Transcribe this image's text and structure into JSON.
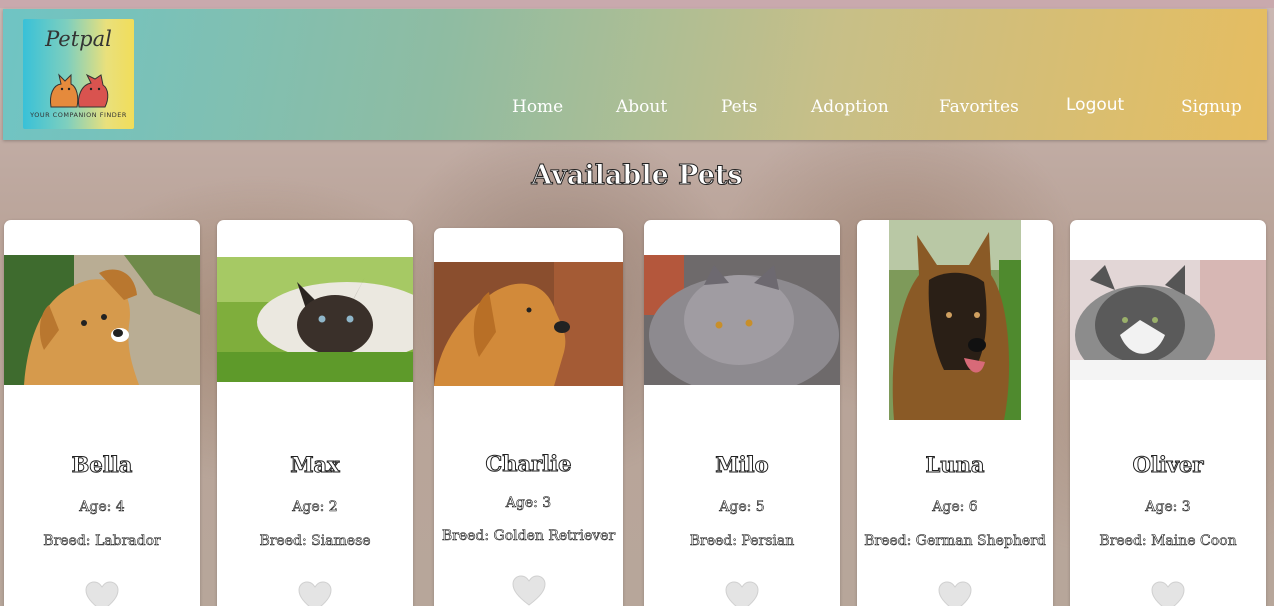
{
  "header": {
    "logo": {
      "name": "Petpal",
      "tagline": "YOUR COMPANION FINDER"
    },
    "nav": [
      {
        "label": "Home"
      },
      {
        "label": "About"
      },
      {
        "label": "Pets"
      },
      {
        "label": "Adoption"
      },
      {
        "label": "Favorites"
      },
      {
        "label": "Logout"
      },
      {
        "label": "Signup"
      }
    ]
  },
  "main": {
    "title": "Available Pets",
    "pets": [
      {
        "name": "Bella",
        "age": "Age: 4",
        "breed": "Breed: Labrador",
        "photo": "dog-photo"
      },
      {
        "name": "Max",
        "age": "Age: 2",
        "breed": "Breed: Siamese",
        "photo": "cat-photo"
      },
      {
        "name": "Charlie",
        "age": "Age: 3",
        "breed": "Breed: Golden Retriever",
        "photo": "dog-photo"
      },
      {
        "name": "Milo",
        "age": "Age: 5",
        "breed": "Breed: Persian",
        "photo": "cat-photo"
      },
      {
        "name": "Luna",
        "age": "Age: 6",
        "breed": "Breed: German Shepherd",
        "photo": "dog-photo"
      },
      {
        "name": "Oliver",
        "age": "Age: 3",
        "breed": "Breed: Maine Coon",
        "photo": "cat-photo"
      }
    ],
    "favorite_icon": "heart-icon"
  },
  "colors": {
    "header_start": "#6fc4c4",
    "header_end": "#e6bd60",
    "heart": "#e4e4e4"
  }
}
